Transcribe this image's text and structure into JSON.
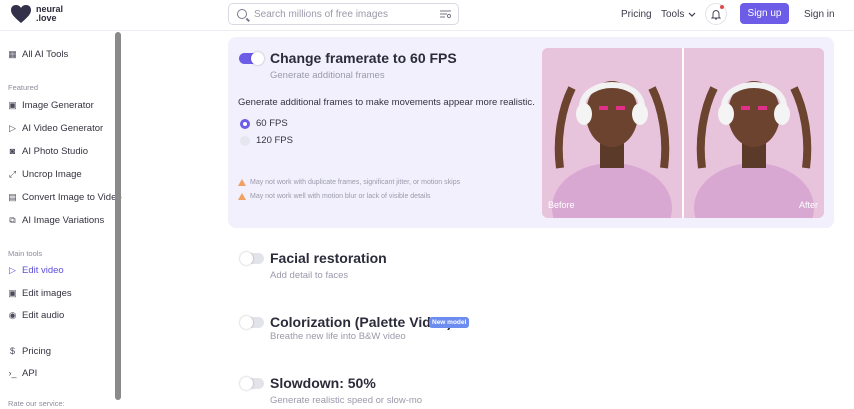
{
  "header": {
    "logo_line1": "neural",
    "logo_line2": ".love",
    "search_placeholder": "Search millions of free images",
    "nav_pricing": "Pricing",
    "nav_tools": "Tools",
    "signup_label": "Sign up",
    "signin_label": "Sign in"
  },
  "sidebar": {
    "all_tools": "All AI Tools",
    "featured_heading": "Featured",
    "featured": [
      {
        "label": "Image Generator",
        "icon": "image-icon"
      },
      {
        "label": "AI Video Generator",
        "icon": "play-icon"
      },
      {
        "label": "AI Photo Studio",
        "icon": "camera-icon"
      },
      {
        "label": "Uncrop Image",
        "icon": "expand-icon"
      },
      {
        "label": "Convert Image to Video",
        "icon": "video-icon"
      },
      {
        "label": "AI Image Variations",
        "icon": "variations-icon"
      }
    ],
    "main_heading": "Main tools",
    "main_tools": [
      {
        "label": "Edit video",
        "icon": "play-icon",
        "active": true
      },
      {
        "label": "Edit images",
        "icon": "image-icon",
        "active": false
      },
      {
        "label": "Edit audio",
        "icon": "audio-icon",
        "active": false
      }
    ],
    "pricing": "Pricing",
    "api": "API",
    "rate_heading": "Rate our service:"
  },
  "features": {
    "framerate": {
      "title": "Change framerate to 60 FPS",
      "subtitle": "Generate additional frames",
      "enabled": true,
      "description": "Generate additional frames to make movements appear more realistic.",
      "options": [
        {
          "label": "60 FPS",
          "selected": true
        },
        {
          "label": "120 FPS",
          "selected": false
        }
      ],
      "warnings": [
        "May not work with duplicate frames, significant jitter, or motion skips",
        "May not work well with motion blur or lack of visible details"
      ],
      "before_label": "Before",
      "after_label": "After"
    },
    "facial": {
      "title": "Facial restoration",
      "subtitle": "Add detail to faces",
      "enabled": false
    },
    "colorization": {
      "title": "Colorization (Palette Video)",
      "badge": "New model",
      "subtitle": "Breathe new life into B&W video",
      "enabled": false
    },
    "slowdown": {
      "title": "Slowdown: 50%",
      "subtitle": "Generate realistic speed or slow-mo",
      "enabled": false
    }
  },
  "colors": {
    "accent": "#6c5ce7",
    "card_bg": "#f2f0fc",
    "badge": "#6c8cf0"
  }
}
